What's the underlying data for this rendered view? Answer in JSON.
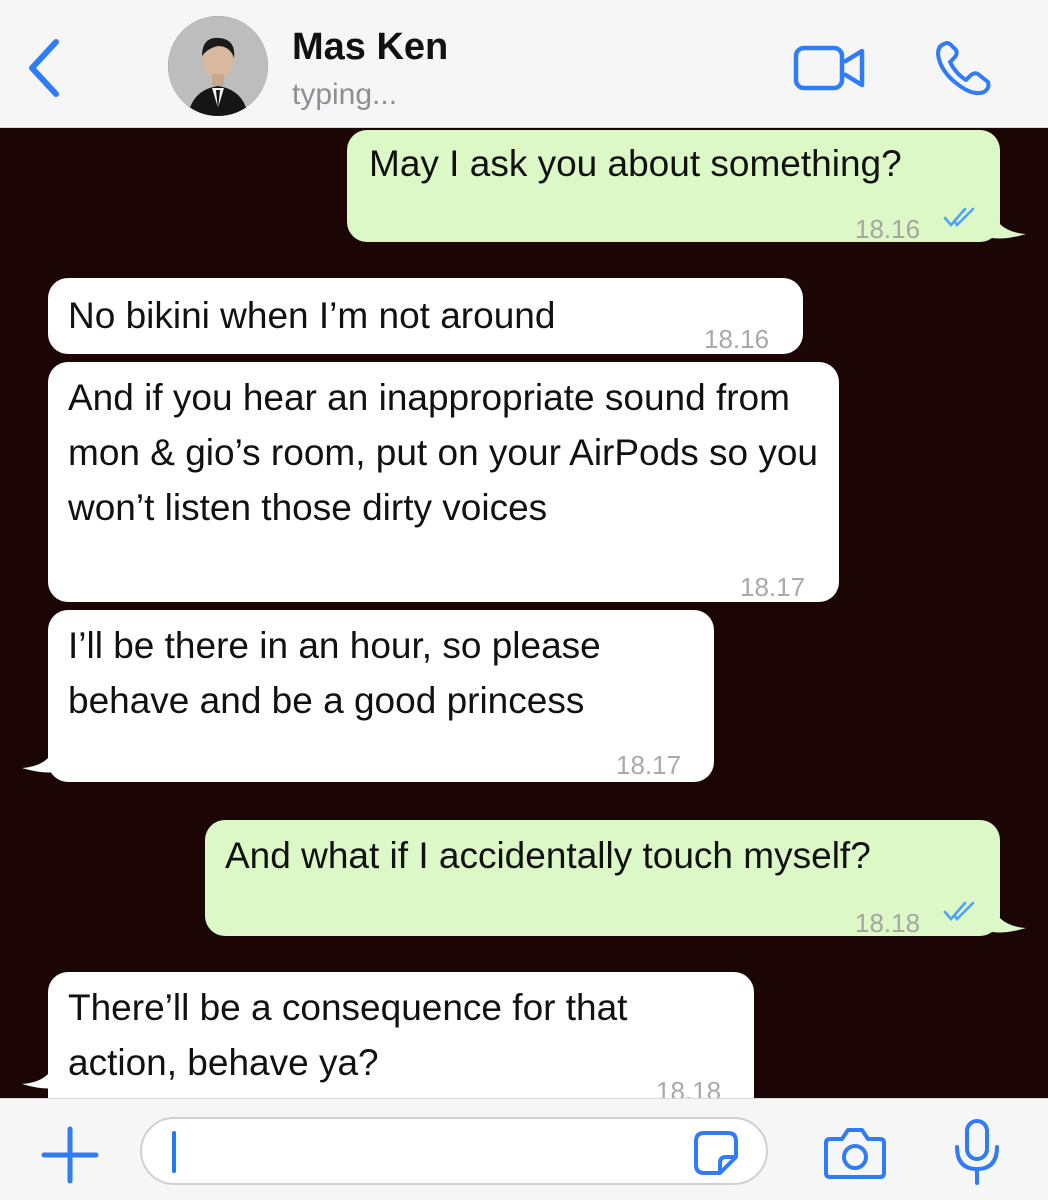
{
  "header": {
    "contact_name": "Mas Ken",
    "status": "typing...",
    "icons": [
      "chevron-left-icon",
      "video-camera-icon",
      "phone-icon"
    ],
    "accent": "#2f7cf6"
  },
  "messages": [
    {
      "direction": "outgoing",
      "text": "May I ask you about something?",
      "time": "18.16",
      "read": true
    },
    {
      "direction": "incoming",
      "text": "No bikini when I’m not around",
      "time": "18.16"
    },
    {
      "direction": "incoming",
      "text": "And if you hear an inappropriate sound from mon & gio’s room, put on your AirPods so you won’t listen those dirty voices",
      "time": "18.17"
    },
    {
      "direction": "incoming",
      "text": "I’ll be there in an hour, so please behave and be a good princess",
      "time": "18.17"
    },
    {
      "direction": "outgoing",
      "text": "And what if I accidentally touch myself?",
      "time": "18.18",
      "read": true
    },
    {
      "direction": "incoming",
      "text": "There’ll be a consequence for that action, behave ya?",
      "time": "18.18"
    }
  ],
  "input_bar": {
    "value": "",
    "icons": [
      "plus-icon",
      "sticker-icon",
      "camera-icon",
      "microphone-icon"
    ]
  },
  "colors": {
    "outgoing_bubble": "#dcf8c6",
    "incoming_bubble": "#ffffff",
    "chat_background": "#1b0505",
    "read_ticks": "#4fa3f7"
  }
}
